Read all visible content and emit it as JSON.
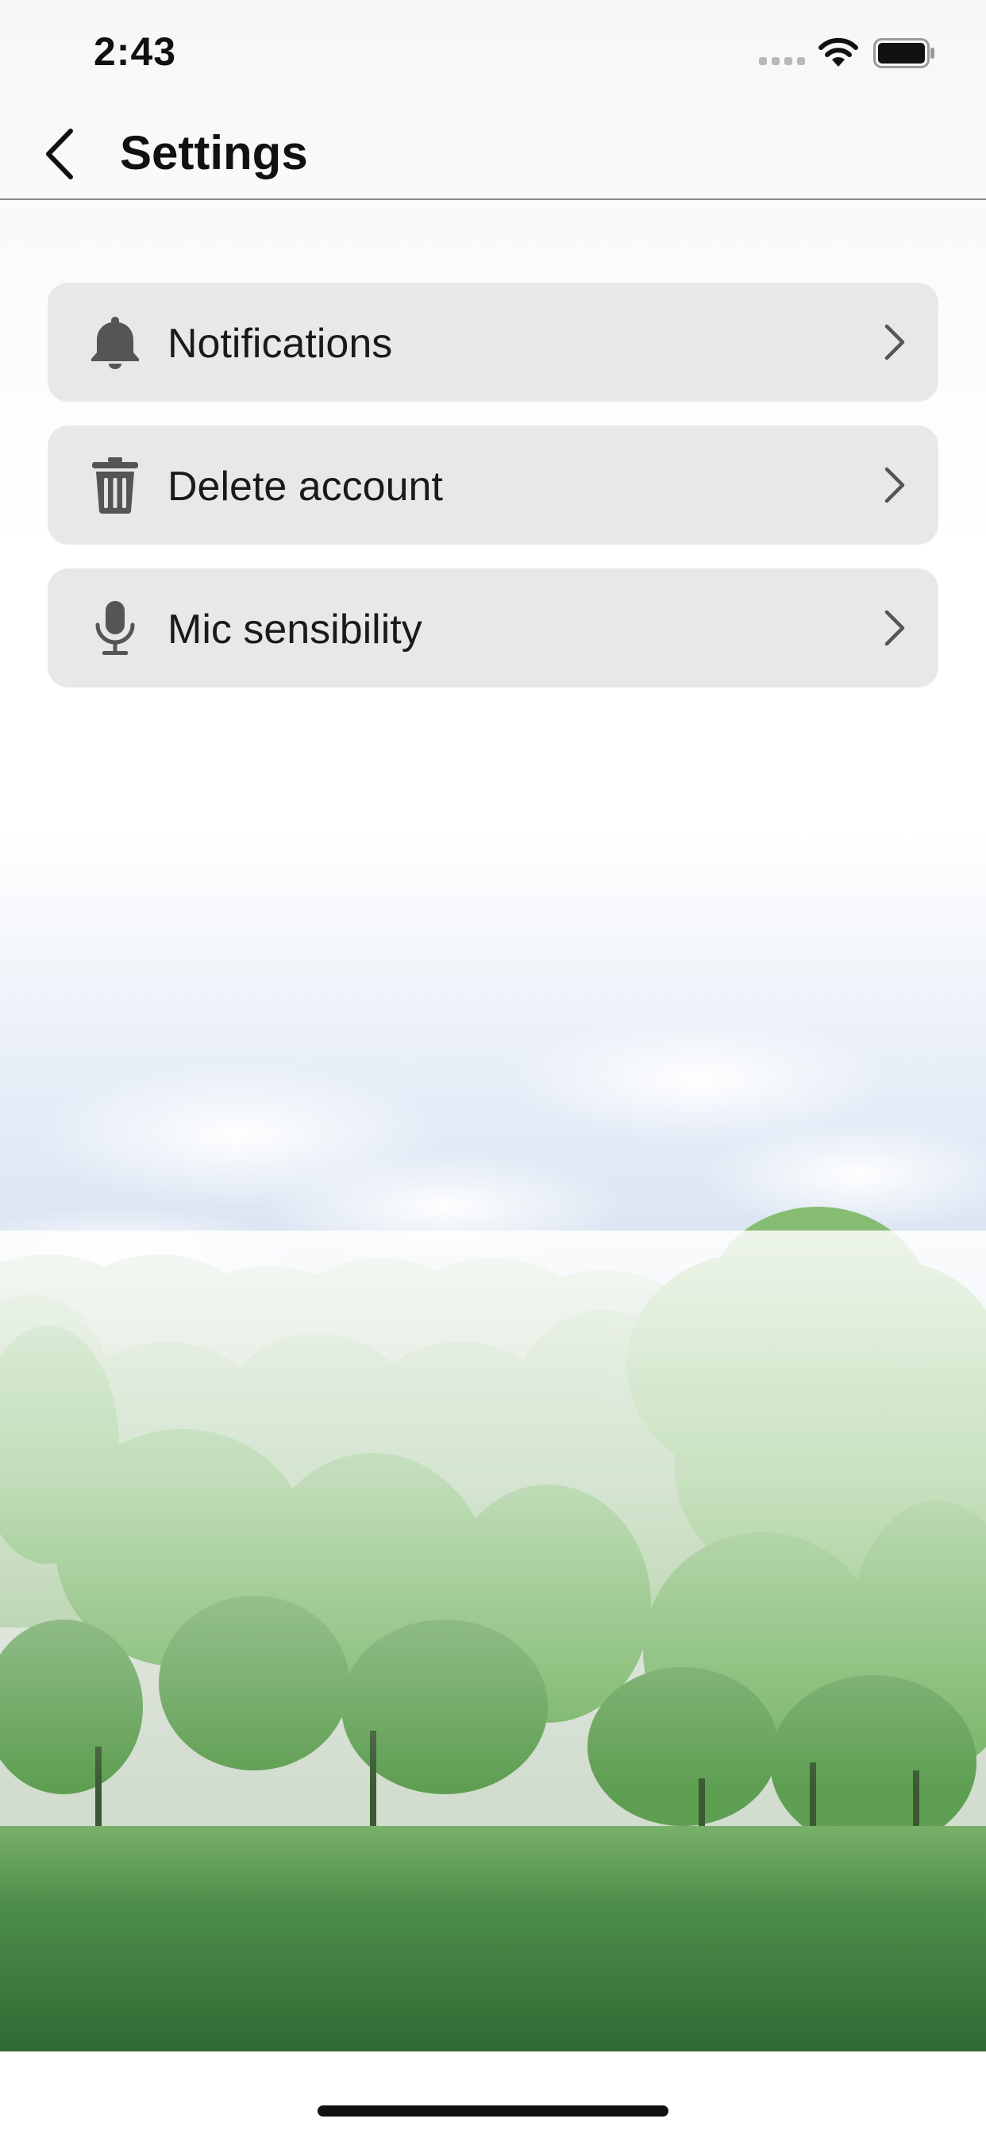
{
  "status_bar": {
    "time": "2:43"
  },
  "nav": {
    "title": "Settings",
    "back_icon": "chevron-left-icon"
  },
  "settings": [
    {
      "label": "Notifications",
      "icon": "bell-icon"
    },
    {
      "label": "Delete account",
      "icon": "trash-icon"
    },
    {
      "label": "Mic sensibility",
      "icon": "microphone-icon"
    }
  ],
  "colors": {
    "row_background": "#e4e4e4",
    "icon": "#555555",
    "chevron": "#555555",
    "forest_dark": "#2f6a34",
    "forest_light": "#7fbe6c"
  }
}
